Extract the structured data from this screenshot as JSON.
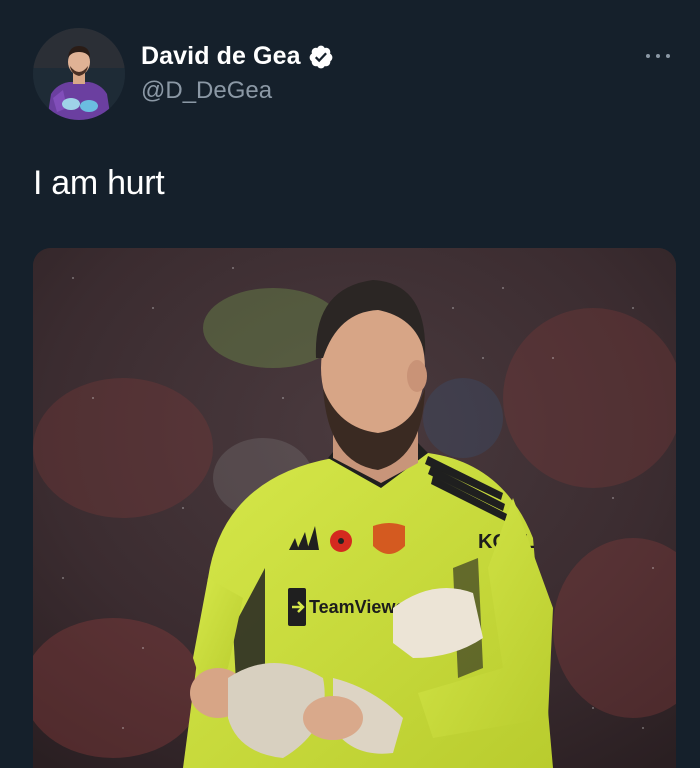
{
  "author": {
    "display_name": "David de Gea",
    "handle": "@D_DeGea",
    "verified": true,
    "avatar_icon": "profile-photo"
  },
  "tweet": {
    "text": "I am hurt"
  },
  "media": {
    "kit_brand": "adidas",
    "sponsor": "TeamViewer",
    "sleeve_sponsor": "KOHL"
  },
  "colors": {
    "background": "#15202b",
    "secondary_text": "#8b98a5",
    "verified_badge": "#ffffff",
    "jersey": "#d7ea3a"
  }
}
